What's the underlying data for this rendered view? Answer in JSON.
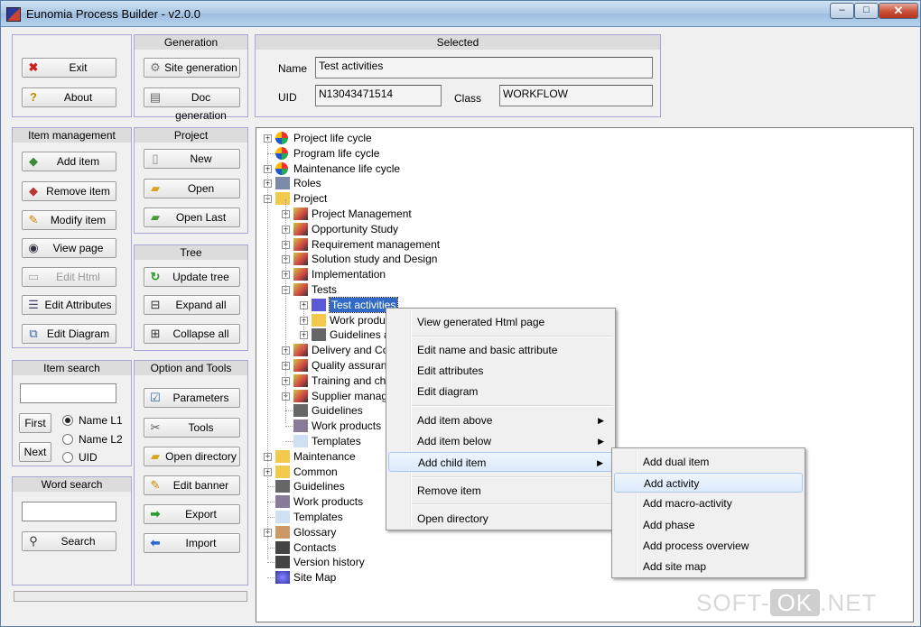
{
  "window": {
    "title": "Eunomia Process Builder - v2.0.0",
    "minimize": "–",
    "maximize": "□",
    "close": "✕"
  },
  "colors": {
    "selection": "#3169c6",
    "panel_border": "#a8a8d8",
    "menu_highlight": "#dceafb"
  },
  "left": {
    "exit": "Exit",
    "about": "About",
    "item_management": {
      "title": "Item management",
      "add": "Add item",
      "remove": "Remove item",
      "modify": "Modify item",
      "view": "View page",
      "edit_html": "Edit Html",
      "edit_attributes": "Edit Attributes",
      "edit_diagram": "Edit Diagram"
    },
    "item_search": {
      "title": "Item search",
      "first": "First",
      "next": "Next",
      "opt1": "Name L1",
      "opt2": "Name L2",
      "opt3": "UID"
    },
    "word_search": {
      "title": "Word search",
      "search": "Search"
    }
  },
  "middle": {
    "generation": {
      "title": "Generation",
      "site": "Site generation",
      "doc": "Doc generation"
    },
    "project": {
      "title": "Project",
      "new": "New",
      "open": "Open",
      "open_last": "Open Last"
    },
    "tree": {
      "title": "Tree",
      "update": "Update tree",
      "expand": "Expand all",
      "collapse": "Collapse all"
    },
    "options": {
      "title": "Option and Tools",
      "parameters": "Parameters",
      "tools": "Tools",
      "open_dir": "Open directory",
      "edit_banner": "Edit banner",
      "export": "Export",
      "import": "Import"
    }
  },
  "selected": {
    "title": "Selected",
    "name_label": "Name",
    "name_value": "Test activities",
    "uid_label": "UID",
    "uid_value": "N13043471514",
    "class_label": "Class",
    "class_value": "WORKFLOW"
  },
  "tree_nodes": [
    {
      "label": "Project life cycle",
      "icon": "lifecycle-icon"
    },
    {
      "label": "Program life cycle",
      "icon": "lifecycle-icon"
    },
    {
      "label": "Maintenance life cycle",
      "icon": "lifecycle-icon"
    },
    {
      "label": "Roles",
      "icon": "roles-icon"
    },
    {
      "label": "Project",
      "icon": "folder-icon"
    },
    {
      "label": "Project Management",
      "icon": "discipline-icon"
    },
    {
      "label": "Opportunity Study",
      "icon": "discipline-icon"
    },
    {
      "label": "Requirement management",
      "icon": "discipline-icon"
    },
    {
      "label": "Solution study and Design",
      "icon": "discipline-icon"
    },
    {
      "label": "Implementation",
      "icon": "discipline-icon"
    },
    {
      "label": "Tests",
      "icon": "discipline-icon"
    },
    {
      "label": "Test activities",
      "icon": "workflow-icon"
    },
    {
      "label": "Work produ",
      "icon": "folder-icon"
    },
    {
      "label": "Guidelines a",
      "icon": "guidelines-icon"
    },
    {
      "label": "Delivery and Co",
      "icon": "discipline-icon"
    },
    {
      "label": "Quality assuranc",
      "icon": "discipline-icon"
    },
    {
      "label": "Training and cha",
      "icon": "discipline-icon"
    },
    {
      "label": "Supplier manage",
      "icon": "discipline-icon"
    },
    {
      "label": "Guidelines",
      "icon": "guidelines-icon"
    },
    {
      "label": "Work products",
      "icon": "workproducts-icon"
    },
    {
      "label": "Templates",
      "icon": "template-icon"
    },
    {
      "label": "Maintenance",
      "icon": "folder-icon"
    },
    {
      "label": "Common",
      "icon": "folder-icon"
    },
    {
      "label": "Guidelines",
      "icon": "guidelines-icon"
    },
    {
      "label": "Work products",
      "icon": "workproducts-icon"
    },
    {
      "label": "Templates",
      "icon": "template-icon"
    },
    {
      "label": "Glossary",
      "icon": "glossary-icon"
    },
    {
      "label": "Contacts",
      "icon": "book-icon"
    },
    {
      "label": "Version history",
      "icon": "book-icon"
    },
    {
      "label": "Site Map",
      "icon": "sitemap-icon"
    }
  ],
  "context_menu": [
    "View generated Html page",
    "Edit name and basic attribute",
    "Edit attributes",
    "Edit diagram",
    "Add item above",
    "Add item below",
    "Add child item",
    "Remove item",
    "Open directory"
  ],
  "submenu": [
    "Add dual item",
    "Add activity",
    "Add macro-activity",
    "Add phase",
    "Add process overview",
    "Add site map"
  ],
  "watermark": {
    "left": "SOFT-",
    "ok": "OK",
    "right": ".NET"
  }
}
